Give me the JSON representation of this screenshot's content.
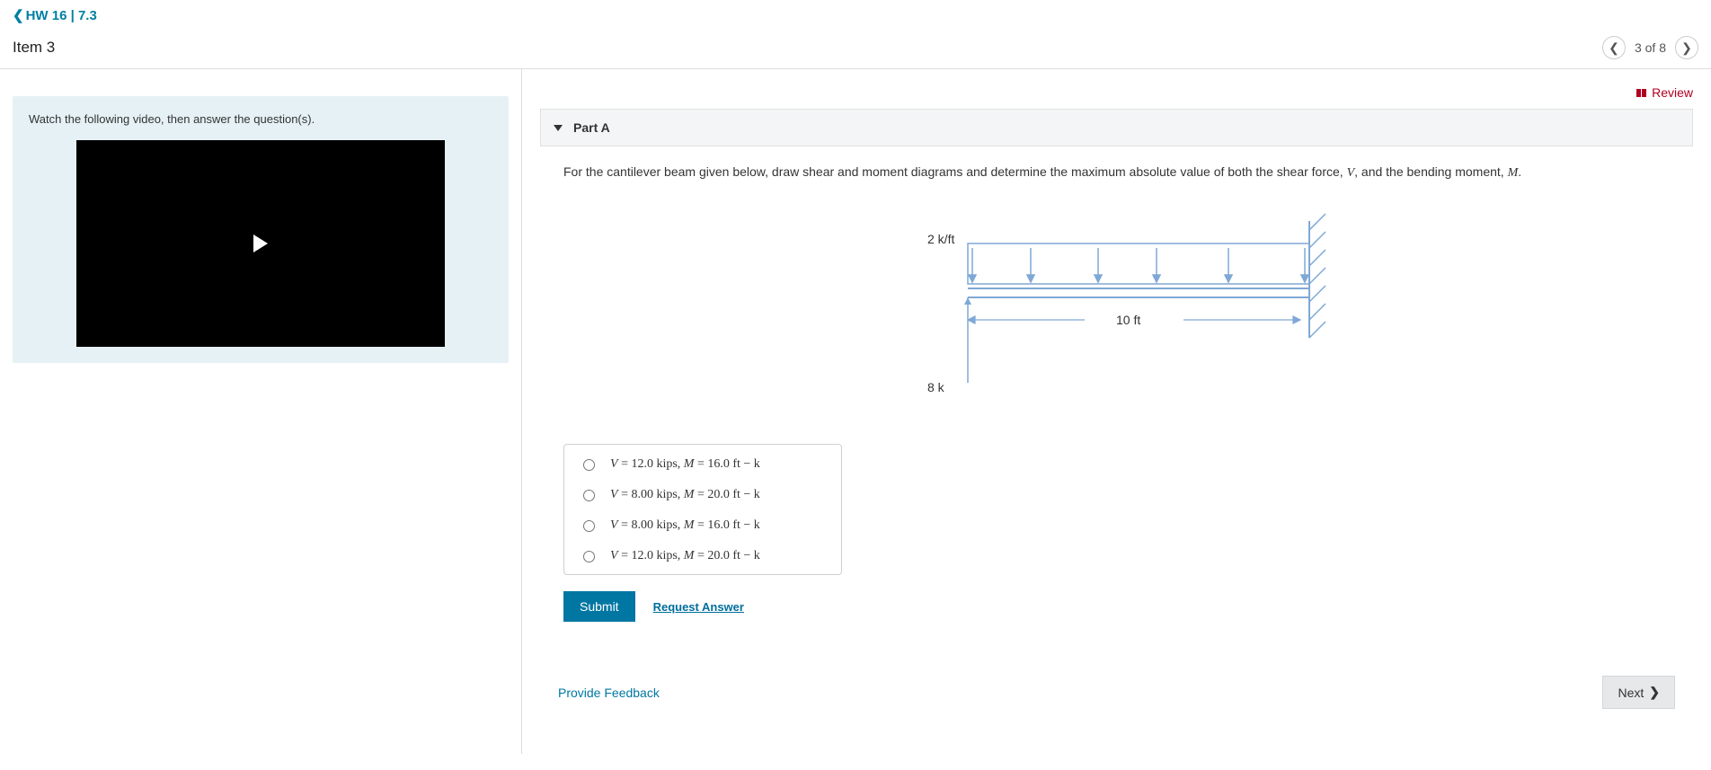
{
  "breadcrumb": {
    "back_label": "HW 16 | 7.3"
  },
  "item": {
    "title": "Item 3"
  },
  "pager": {
    "text": "3 of 8"
  },
  "review": {
    "label": "Review"
  },
  "left": {
    "instruction": "Watch the following video, then answer the question(s)."
  },
  "part": {
    "label": "Part A",
    "prompt_prefix": "For the cantilever beam given below, draw shear and moment diagrams and determine the maximum absolute value of both the shear force, ",
    "prompt_v": "V",
    "prompt_mid": ", and the bending moment, ",
    "prompt_m": "M",
    "prompt_suffix": "."
  },
  "diagram": {
    "load_label": "2 k/ft",
    "length_label": "10 ft",
    "point_load_label": "8 k"
  },
  "choices": [
    {
      "v_label": "V",
      "eq1": " = 12.0 kips, ",
      "m_label": "M",
      "eq2": " = 16.0 ft − k"
    },
    {
      "v_label": "V",
      "eq1": " = 8.00 kips, ",
      "m_label": "M",
      "eq2": " = 20.0 ft − k"
    },
    {
      "v_label": "V",
      "eq1": " = 8.00 kips, ",
      "m_label": "M",
      "eq2": " = 16.0 ft − k"
    },
    {
      "v_label": "V",
      "eq1": " = 12.0 kips, ",
      "m_label": "M",
      "eq2": " = 20.0 ft − k"
    }
  ],
  "actions": {
    "submit": "Submit",
    "request_answer": "Request Answer"
  },
  "bottom": {
    "provide_feedback": "Provide Feedback",
    "next": "Next"
  }
}
